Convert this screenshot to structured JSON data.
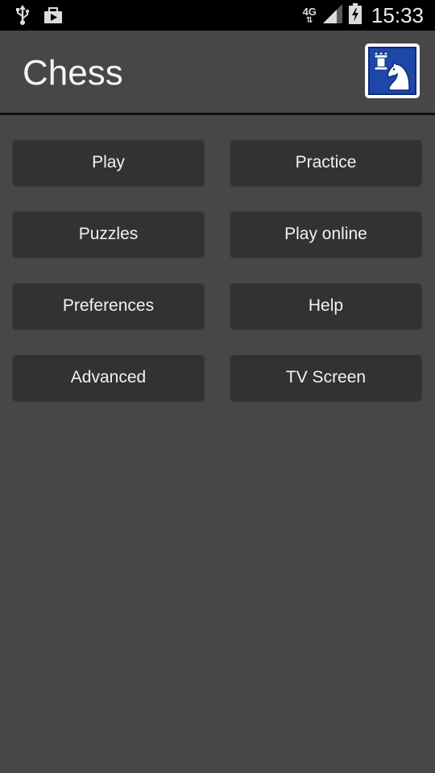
{
  "status_bar": {
    "network": "4G",
    "network_arrows": "⇅",
    "time": "15:33",
    "left_icons": [
      "usb-icon",
      "media-notification-icon"
    ],
    "right_icons": [
      "signal-icon",
      "battery-charging-icon"
    ]
  },
  "app": {
    "title": "Chess",
    "logo_icon": "chess-rook-knight-logo-icon",
    "accent_color": "#1e47a8"
  },
  "menu": {
    "play": "Play",
    "practice": "Practice",
    "puzzles": "Puzzles",
    "play_online": "Play online",
    "preferences": "Preferences",
    "help": "Help",
    "advanced": "Advanced",
    "tv_screen": "TV Screen"
  }
}
